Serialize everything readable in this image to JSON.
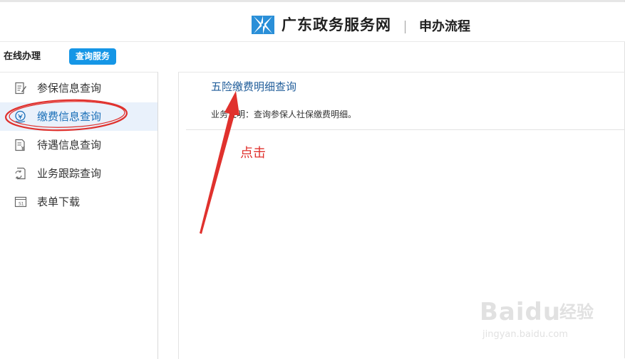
{
  "header": {
    "site_name": "广东政务服务网",
    "page_title": "申办流程"
  },
  "tabs": {
    "online_label": "在线办理",
    "query_label": "查询服务"
  },
  "sidebar": {
    "items": [
      {
        "label": "参保信息查询",
        "icon": "edit-document-icon"
      },
      {
        "label": "缴费信息查询",
        "icon": "payment-icon",
        "active": true
      },
      {
        "label": "待遇信息查询",
        "icon": "benefit-document-icon"
      },
      {
        "label": "业务跟踪查询",
        "icon": "refresh-document-icon"
      },
      {
        "label": "表单下载",
        "icon": "form-download-icon"
      }
    ]
  },
  "main": {
    "link_title": "五险缴费明细查询",
    "description": "业务说明：查询参保人社保缴费明细。"
  },
  "annotation": {
    "text": "点击",
    "color": "#e0312d"
  },
  "watermark": {
    "brand": "Baidu",
    "brand_cn": "经验",
    "url": "jingyan.baidu.com"
  },
  "colors": {
    "accent": "#1596e6",
    "active_bg": "#e9f1fb",
    "link": "#1f5c99"
  }
}
